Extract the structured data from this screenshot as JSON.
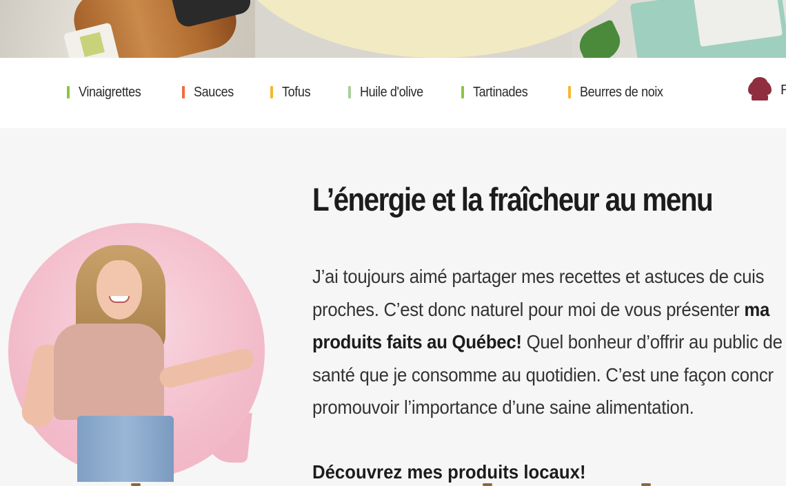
{
  "nav": {
    "items": [
      {
        "label": "Vinaigrettes",
        "color": "#8cc63f"
      },
      {
        "label": "Sauces",
        "color": "#f26c3a"
      },
      {
        "label": "Tofus",
        "color": "#f6b72e"
      },
      {
        "label": "Huile d'olive",
        "color": "#a9cf9a"
      },
      {
        "label": "Tartinades",
        "color": "#8cc63f"
      },
      {
        "label": "Beurres de noix",
        "color": "#f6b72e"
      }
    ],
    "cut_label": "R"
  },
  "main": {
    "headline": "L’énergie et la fraîcheur au menu",
    "paragraph": {
      "line1": "J’ai toujours aimé partager mes recettes et astuces de cuis",
      "line2_a": "proches. C’est donc naturel pour moi de vous présenter ",
      "line2_b": "ma",
      "line3_a": "produits faits au Québec!",
      "line3_b": " Quel bonheur d’offrir au public de",
      "line4": "santé que je consomme au quotidien. C’est une façon concr",
      "line5": "promouvoir l’importance d’une saine alimentation."
    },
    "subheading": "Découvrez mes produits locaux!"
  },
  "colors": {
    "accent_pink": "#f3bccb",
    "chef_icon": "#8e2e3e",
    "hero_cream": "#f2eac2"
  }
}
